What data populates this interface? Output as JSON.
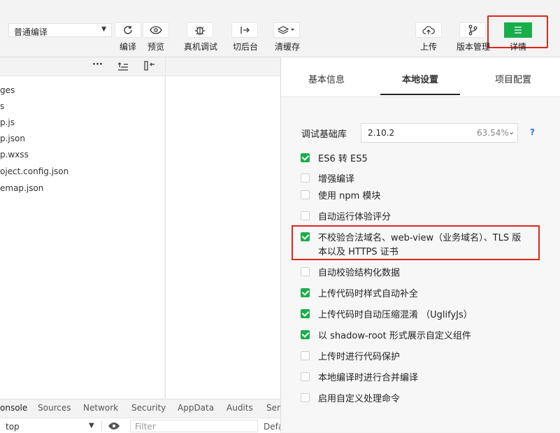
{
  "toolbar": {
    "mode_select": "普通编译",
    "buttons": [
      {
        "label": "编译",
        "icon": "refresh-icon"
      },
      {
        "label": "预览",
        "icon": "eye-icon"
      },
      {
        "label": "真机调试",
        "icon": "bug-icon"
      },
      {
        "label": "切后台",
        "icon": "switch-icon"
      },
      {
        "label": "清缓存",
        "icon": "layers-icon"
      },
      {
        "label": "上传",
        "icon": "cloud-upload-icon"
      },
      {
        "label": "版本管理",
        "icon": "git-branch-icon"
      },
      {
        "label": "详情",
        "icon": "menu-icon"
      }
    ]
  },
  "files": [
    "ges",
    "s",
    "p.js",
    "p.json",
    "p.wxss",
    "oject.config.json",
    "emap.json"
  ],
  "console": {
    "tabs": [
      "onsole",
      "Sources",
      "Network",
      "Security",
      "AppData",
      "Audits",
      "Sen"
    ],
    "context": "top",
    "filter_placeholder": "Filter",
    "level": "Defa"
  },
  "detail": {
    "tabs": [
      "基本信息",
      "本地设置",
      "项目配置"
    ],
    "active_tab": "本地设置",
    "lib_label": "调试基础库",
    "lib_version": "2.10.2",
    "lib_percent": "63.54%",
    "help": "?",
    "options": [
      {
        "label": "ES6 转 ES5",
        "checked": true
      },
      {
        "label": "增强编译",
        "checked": false
      },
      {
        "label": "使用 npm 模块",
        "checked": false
      },
      {
        "label": "自动运行体验评分",
        "checked": false
      },
      {
        "label": "不校验合法域名、web-view（业务域名）、TLS 版本以及 HTTPS 证书",
        "checked": true
      },
      {
        "label": "自动校验结构化数据",
        "checked": false
      },
      {
        "label": "上传代码时样式自动补全",
        "checked": true
      },
      {
        "label": "上传代码时自动压缩混淆 （UglifyJs）",
        "checked": true
      },
      {
        "label": "以 shadow-root 形式展示自定义组件",
        "checked": true
      },
      {
        "label": "上传时进行代码保护",
        "checked": false
      },
      {
        "label": "本地编译时进行合并编译",
        "checked": false
      },
      {
        "label": "启用自定义处理命令",
        "checked": false
      }
    ]
  },
  "colors": {
    "accent": "#1aad4b",
    "highlight": "#e0251c"
  }
}
